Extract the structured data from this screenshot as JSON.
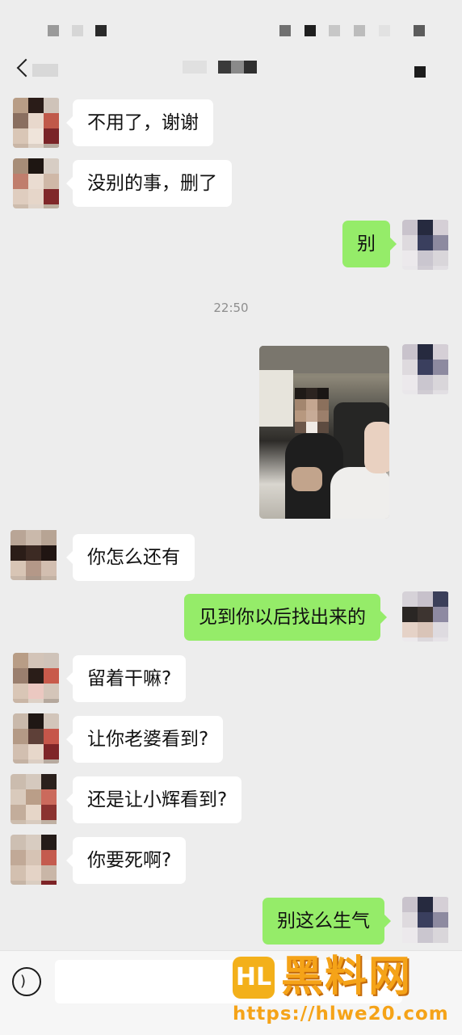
{
  "status_bar": {},
  "nav": {
    "title": ""
  },
  "messages": {
    "m1": "不用了，谢谢",
    "m2": "没别的事，删了",
    "m3": "别",
    "time": "22:50",
    "m5": "你怎么还有",
    "m6": "见到你以后找出来的",
    "m7": "留着干嘛?",
    "m8": "让你老婆看到?",
    "m9": "还是让小辉看到?",
    "m10": "你要死啊?",
    "m11": "别这么生气"
  },
  "input": {
    "placeholder": ""
  },
  "watermark": {
    "logo_text": "HL",
    "brand": "黑料网",
    "url": "https://hlwe20.com"
  },
  "colors": {
    "background": "#ededed",
    "outgoing_bubble": "#95ec69",
    "incoming_bubble": "#ffffff",
    "watermark": "#f5a318"
  },
  "icons": {
    "back": "chevron-left-icon",
    "more": "more-icon",
    "voice": "voice-icon"
  }
}
